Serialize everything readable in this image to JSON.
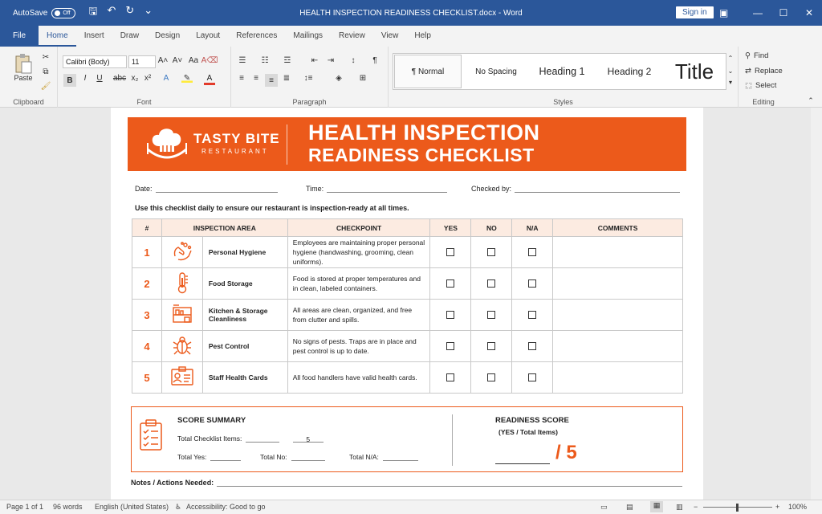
{
  "titlebar": {
    "autosave_label": "AutoSave",
    "autosave_state": "Off",
    "document_title": "HEALTH INSPECTION READINESS CHECKLIST.docx - Word",
    "signin_label": "Sign in"
  },
  "menu_tabs": [
    "File",
    "Home",
    "Insert",
    "Draw",
    "Design",
    "Layout",
    "References",
    "Mailings",
    "Review",
    "View",
    "Help"
  ],
  "ribbon": {
    "clipboard": {
      "paste_label": "Paste",
      "group_label": "Clipboard"
    },
    "font": {
      "font_name": "Calibri (Body)",
      "font_size": "11",
      "group_label": "Font"
    },
    "paragraph": {
      "group_label": "Paragraph"
    },
    "styles": {
      "items": [
        "¶ Normal",
        "No Spacing",
        "Heading 1",
        "Heading 2",
        "Title"
      ],
      "group_label": "Styles"
    },
    "editing": {
      "find_label": "Find",
      "replace_label": "Replace",
      "select_label": "Select",
      "group_label": "Editing"
    }
  },
  "document": {
    "brand_name": "TASTY BITE",
    "brand_sub": "RESTAURANT",
    "title_line1": "HEALTH INSPECTION",
    "title_line2": "READINESS CHECKLIST",
    "date_label": "Date:",
    "time_label": "Time:",
    "checked_by_label": "Checked by:",
    "intro": "Use this checklist daily to ensure our restaurant is inspection-ready at all times.",
    "table_headers": [
      "#",
      "INSPECTION AREA",
      "CHECKPOINT",
      "YES",
      "NO",
      "N/A",
      "COMMENTS"
    ],
    "rows": [
      {
        "num": "1",
        "area": "Personal Hygiene",
        "icon": "hand-washing-icon",
        "checkpoint": "Employees are maintaining proper personal hygiene (handwashing, grooming, clean uniforms)."
      },
      {
        "num": "2",
        "area": "Food Storage",
        "icon": "thermometer-icon",
        "checkpoint": "Food is stored at proper temperatures and in clean, labeled containers."
      },
      {
        "num": "3",
        "area": "Kitchen & Storage Cleanliness",
        "icon": "kitchen-shelf-icon",
        "checkpoint": "All areas are clean, organized, and free from clutter and spills."
      },
      {
        "num": "4",
        "area": "Pest Control",
        "icon": "bug-icon",
        "checkpoint": "No signs of pests. Traps are in place and pest control is up to date."
      },
      {
        "num": "5",
        "area": "Staff Health Cards",
        "icon": "id-card-icon",
        "checkpoint": "All food handlers have valid health cards."
      }
    ],
    "summary": {
      "title": "SCORE SUMMARY",
      "total_items_label": "Total Checklist Items:",
      "total_items_value": "5",
      "total_yes_label": "Total Yes:",
      "total_no_label": "Total No:",
      "total_na_label": "Total N/A:",
      "readiness_title": "READINESS SCORE",
      "readiness_sub": "(YES / Total Items)",
      "readiness_denominator": "/ 5"
    },
    "notes_label": "Notes / Actions Needed:"
  },
  "statusbar": {
    "page": "Page 1 of 1",
    "words": "96 words",
    "language": "English (United States)",
    "accessibility": "Accessibility: Good to go",
    "zoom": "100%"
  },
  "colors": {
    "accent": "#ec5a1b",
    "word_blue": "#2b579a"
  }
}
